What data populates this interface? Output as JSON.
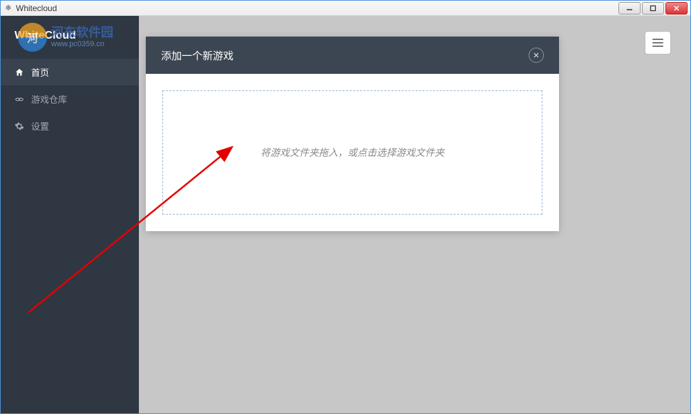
{
  "titlebar": {
    "title": "Whitecloud"
  },
  "watermark": {
    "line1": "河东软件园",
    "line2": "www.pc0359.cn"
  },
  "brand": "WhiteCloud",
  "sidebar": {
    "items": [
      {
        "icon": "home",
        "label": "首页",
        "active": true
      },
      {
        "icon": "link",
        "label": "游戏仓库",
        "active": false
      },
      {
        "icon": "gear",
        "label": "设置",
        "active": false
      }
    ]
  },
  "modal": {
    "title": "添加一个新游戏",
    "dropzone_hint": "将游戏文件夹拖入，或点击选择游戏文件夹"
  }
}
